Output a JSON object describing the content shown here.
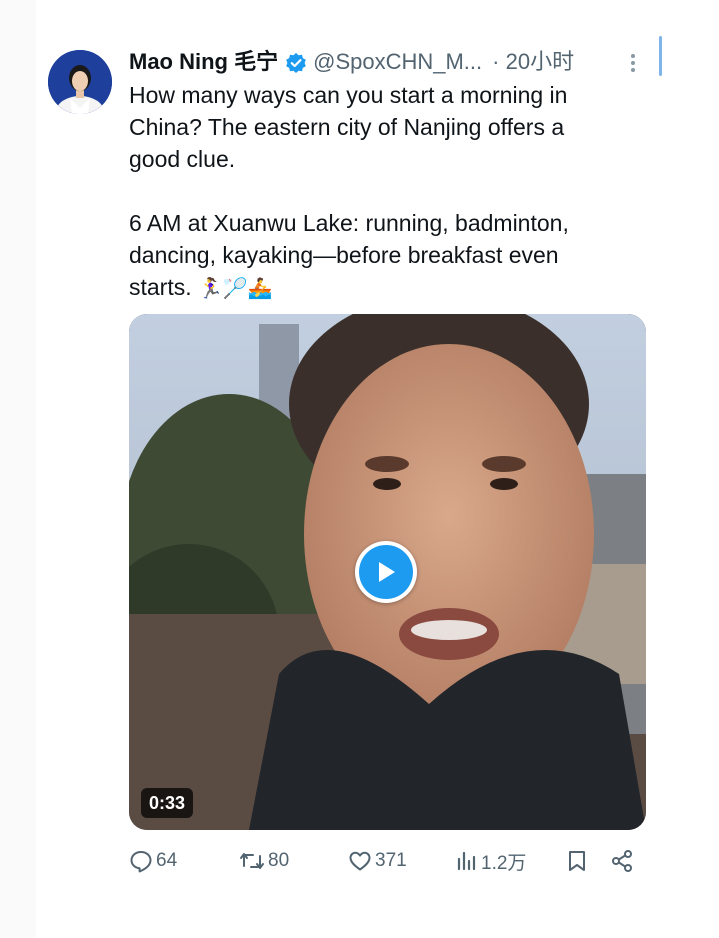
{
  "tweet": {
    "author_name": "Mao Ning 毛宁",
    "handle": "@SpoxCHN_M...",
    "time": "· 20小时",
    "text_lines": [
      "How many ways can you start a morning in",
      "China? The eastern city of Nanjing offers a",
      "good clue.",
      "6 AM at Xuanwu Lake: running, badminton,",
      "dancing, kayaking—before breakfast even",
      "starts."
    ],
    "emojis": "🏃‍♀️🏸🚣",
    "video": {
      "duration": "0:33"
    }
  },
  "actions": {
    "replies": "64",
    "retweets": "80",
    "likes": "371",
    "views": "1.2万"
  },
  "colors": {
    "verified_blue": "#1d9bf0",
    "secondary_text": "#536471",
    "primary_text": "#0f1419",
    "play_button": "#1d9bf0"
  },
  "icons": [
    "verified-icon",
    "more-icon",
    "reply-icon",
    "retweet-icon",
    "like-icon",
    "views-icon",
    "bookmark-icon",
    "share-icon",
    "play-icon"
  ]
}
